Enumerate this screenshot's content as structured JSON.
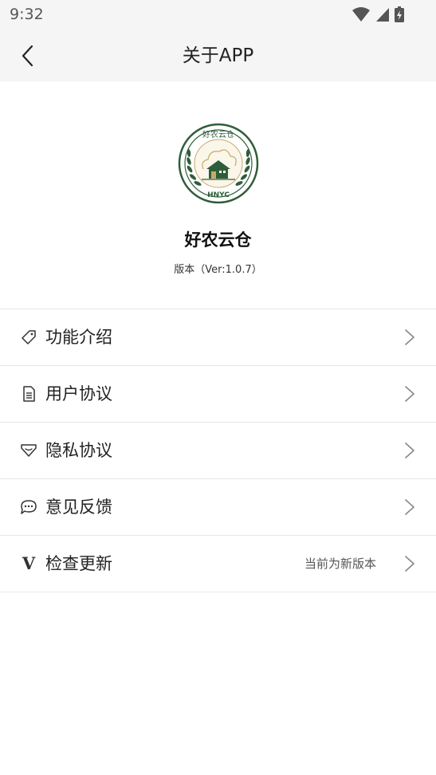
{
  "status_bar": {
    "time": "9:32"
  },
  "nav": {
    "title": "关于APP"
  },
  "app": {
    "name": "好农云仓",
    "version": "版本（Ver:1.0.7）",
    "logo": {
      "top_text": "好农云仓",
      "bottom_text": "HNYC",
      "primary_color": "#2f5d3a",
      "accent_color": "#c9a96b"
    }
  },
  "menu": {
    "items": [
      {
        "label": "功能介绍",
        "icon": "tag-icon"
      },
      {
        "label": "用户协议",
        "icon": "document-icon"
      },
      {
        "label": "隐私协议",
        "icon": "shield-heart-icon"
      },
      {
        "label": "意见反馈",
        "icon": "chat-bubble-icon"
      },
      {
        "label": "检查更新",
        "icon": "version-v-icon",
        "value": "当前为新版本"
      }
    ]
  },
  "colors": {
    "header_bg": "#f5f5f5",
    "divider": "#e6e6e6",
    "text": "#222222"
  }
}
